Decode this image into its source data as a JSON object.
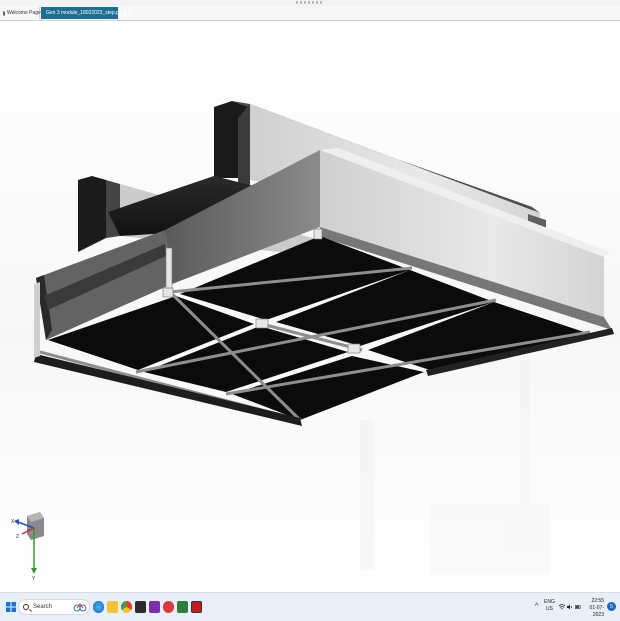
{
  "window": {
    "tabs": [
      {
        "label": "Welcome Page",
        "active": false
      },
      {
        "label": "Gen 3 module_18032023_step.prt",
        "active": true
      }
    ],
    "tab_close_glyph": "x"
  },
  "viewport": {
    "background": "#ffffff",
    "model_colors": {
      "panel_dark": "#0a0a0a",
      "frame_light": "#e3e3e3",
      "frame_mid": "#9c9c9c",
      "frame_shade": "#5c5c5c"
    },
    "triad": {
      "axis_x": "X",
      "axis_y": "Y",
      "axis_z": "Z"
    }
  },
  "taskbar": {
    "start_icon": "windows-start-icon",
    "search_placeholder": "Search",
    "pinned_apps": [
      "copilot-icon",
      "edge-icon",
      "file-explorer-icon",
      "chrome-icon",
      "app-icon",
      "onenote-icon",
      "app-icon",
      "app-icon",
      "app-icon",
      "nx-icon"
    ],
    "tray": {
      "language_line1": "ENG",
      "language_line2": "US",
      "time": "22:55",
      "date": "01-07-2023",
      "notification_count": "5"
    }
  }
}
